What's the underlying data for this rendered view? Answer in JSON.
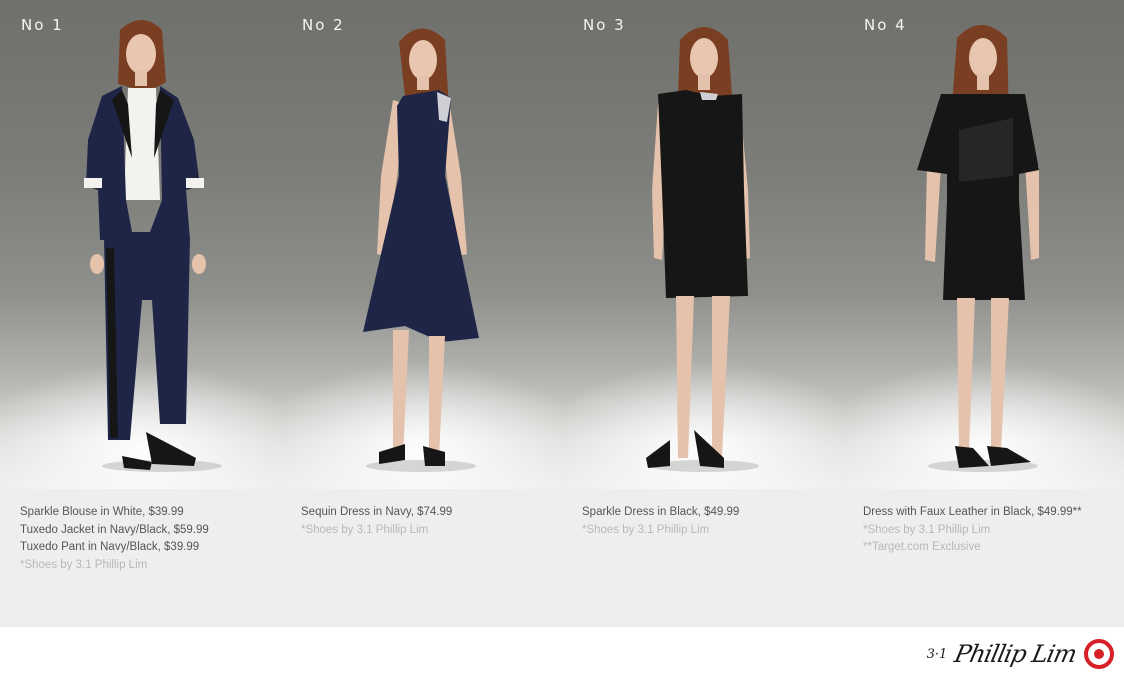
{
  "looks": [
    {
      "number": "No 1",
      "items": [
        "Sparkle Blouse in White, $39.99",
        "Tuxedo Jacket in Navy/Black, $59.99",
        "Tuxedo Pant in Navy/Black, $39.99"
      ],
      "notes": [
        "*Shoes by 3.1 Phillip Lim"
      ]
    },
    {
      "number": "No 2",
      "items": [
        "Sequin Dress in Navy, $74.99"
      ],
      "notes": [
        "*Shoes by 3.1 Phillip Lim"
      ]
    },
    {
      "number": "No 3",
      "items": [
        "Sparkle Dress in Black, $49.99"
      ],
      "notes": [
        "*Shoes by 3.1 Phillip Lim"
      ]
    },
    {
      "number": "No 4",
      "items": [
        "Dress with Faux Leather in Black, $49.99**"
      ],
      "notes": [
        "*Shoes by 3.1 Phillip Lim",
        "**Target.com Exclusive"
      ]
    }
  ],
  "footer": {
    "brand_prefix": "3·1",
    "brand_signature": "Phillip Lim",
    "logo_icon": "target-bullseye-icon"
  },
  "colors": {
    "navy": "#1f2547",
    "black": "#161616",
    "target_red": "#d61f26"
  }
}
